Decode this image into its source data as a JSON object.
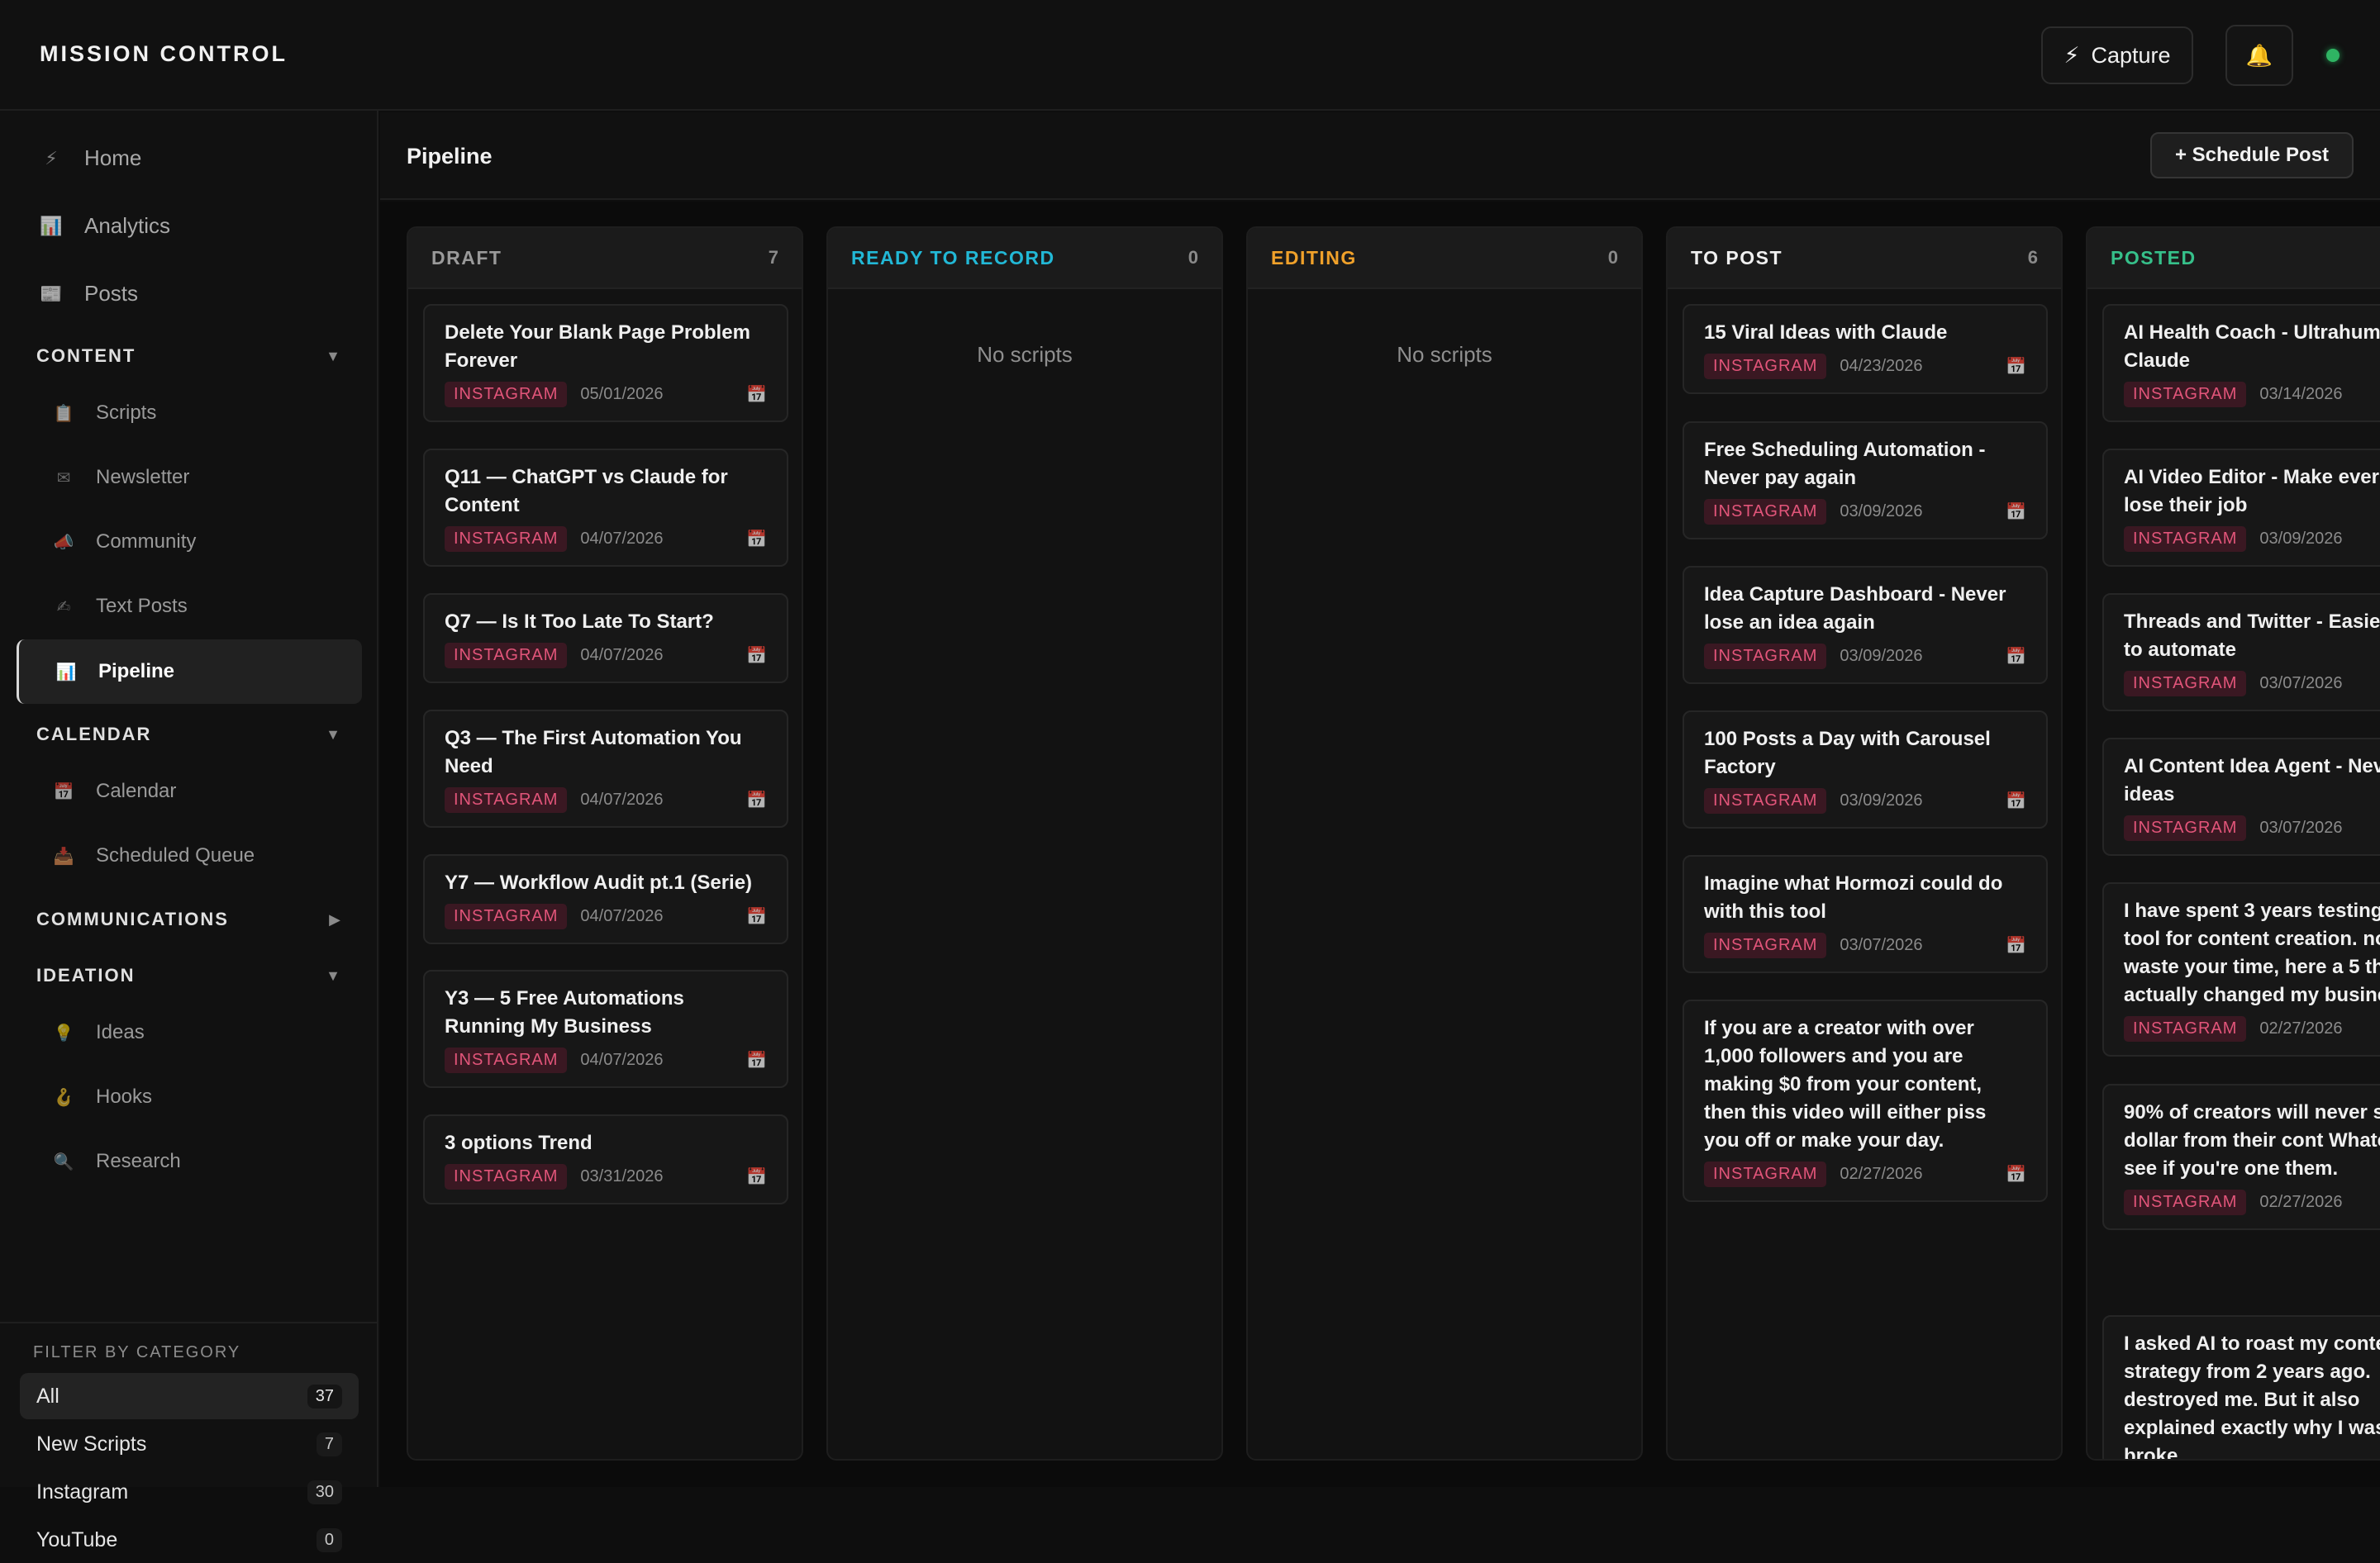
{
  "app": {
    "brand": "MISSION CONTROL"
  },
  "topbar": {
    "capture_label": "Capture",
    "capture_icon": "⚡",
    "bell_icon": "🔔"
  },
  "sidebar": {
    "nav": [
      {
        "label": "Home",
        "icon": "⚡"
      },
      {
        "label": "Analytics",
        "icon": "📊"
      },
      {
        "label": "Posts",
        "icon": "📰"
      }
    ],
    "sections": {
      "content": {
        "title": "CONTENT",
        "chevron": "▼",
        "items": [
          {
            "label": "Scripts",
            "icon": "📋"
          },
          {
            "label": "Newsletter",
            "icon": "✉"
          },
          {
            "label": "Community",
            "icon": "📣"
          },
          {
            "label": "Text Posts",
            "icon": "✍"
          },
          {
            "label": "Pipeline",
            "icon": "📊"
          }
        ]
      },
      "calendar": {
        "title": "CALENDAR",
        "chevron": "▼",
        "items": [
          {
            "label": "Calendar",
            "icon": "📅"
          },
          {
            "label": "Scheduled Queue",
            "icon": "📥"
          }
        ]
      },
      "communications": {
        "title": "COMMUNICATIONS",
        "chevron": "▶"
      },
      "ideation": {
        "title": "IDEATION",
        "chevron": "▼",
        "items": [
          {
            "label": "Ideas",
            "icon": "💡"
          },
          {
            "label": "Hooks",
            "icon": "🪝"
          },
          {
            "label": "Research",
            "icon": "🔍"
          }
        ]
      }
    },
    "filter": {
      "title": "FILTER BY CATEGORY",
      "rows": [
        {
          "label": "All",
          "count": "37"
        },
        {
          "label": "New Scripts",
          "count": "7"
        },
        {
          "label": "Instagram",
          "count": "30"
        },
        {
          "label": "YouTube",
          "count": "0"
        }
      ]
    }
  },
  "main": {
    "title": "Pipeline",
    "schedule_label": "+ Schedule Post"
  },
  "colors": {
    "draft": "#9a9a9a",
    "ready": "#22b8d6",
    "editing": "#f0a12a",
    "to_post": "#f0f0f0",
    "posted": "#36c08a",
    "badge": "#e2557a"
  },
  "columns": {
    "draft": {
      "title": "DRAFT",
      "count": "7",
      "cards": [
        {
          "title": "Delete Your Blank Page Problem Forever",
          "tag": "INSTAGRAM",
          "date": "05/01/2026"
        },
        {
          "title": "Q11 — ChatGPT vs Claude for Content",
          "tag": "INSTAGRAM",
          "date": "04/07/2026"
        },
        {
          "title": "Q7 — Is It Too Late To Start?",
          "tag": "INSTAGRAM",
          "date": "04/07/2026"
        },
        {
          "title": "Q3 — The First Automation You Need",
          "tag": "INSTAGRAM",
          "date": "04/07/2026"
        },
        {
          "title": "Y7 — Workflow Audit pt.1 (Serie)",
          "tag": "INSTAGRAM",
          "date": "04/07/2026"
        },
        {
          "title": "Y3 — 5 Free Automations Running My Business",
          "tag": "INSTAGRAM",
          "date": "04/07/2026"
        },
        {
          "title": "3 options Trend",
          "tag": "INSTAGRAM",
          "date": "03/31/2026"
        }
      ]
    },
    "ready": {
      "title": "READY TO RECORD",
      "count": "0",
      "empty": "No scripts"
    },
    "editing": {
      "title": "EDITING",
      "count": "0",
      "empty": "No scripts"
    },
    "to_post": {
      "title": "TO POST",
      "count": "6",
      "cards": [
        {
          "title": "15 Viral Ideas with Claude",
          "tag": "INSTAGRAM",
          "date": "04/23/2026"
        },
        {
          "title": "Free Scheduling Automation - Never pay again",
          "tag": "INSTAGRAM",
          "date": "03/09/2026"
        },
        {
          "title": "Idea Capture Dashboard - Never lose an idea again",
          "tag": "INSTAGRAM",
          "date": "03/09/2026"
        },
        {
          "title": "100 Posts a Day with Carousel Factory",
          "tag": "INSTAGRAM",
          "date": "03/09/2026"
        },
        {
          "title": "Imagine what Hormozi could do with this tool",
          "tag": "INSTAGRAM",
          "date": "03/07/2026"
        },
        {
          "title": "If you are a creator with over 1,000 followers and you are making $0 from your content, then this video will either piss you off or make your day.",
          "tag": "INSTAGRAM",
          "date": "02/27/2026"
        }
      ]
    },
    "posted": {
      "title": "POSTED",
      "cards": [
        {
          "title": "AI Health Coach - Ultrahum Claude",
          "tag": "INSTAGRAM",
          "date": "03/14/2026"
        },
        {
          "title": "AI Video Editor - Make ever editor lose their job",
          "tag": "INSTAGRAM",
          "date": "03/09/2026"
        },
        {
          "title": "Threads and Twitter - Easie social to automate",
          "tag": "INSTAGRAM",
          "date": "03/07/2026"
        },
        {
          "title": "AI Content Idea Agent - Nev out of ideas",
          "tag": "INSTAGRAM",
          "date": "03/07/2026"
        },
        {
          "title": "I have spent 3 years testing AI tool for content creation. not waste your time, here a 5 that actually changed my business.",
          "tag": "INSTAGRAM",
          "date": "02/27/2026"
        },
        {
          "title": "90% of creators will never single dollar from their cont Whatch to see if you're one them.",
          "tag": "INSTAGRAM",
          "date": "02/27/2026"
        },
        {
          "title": "I asked AI to roast my conte strategy from 2 years ago. destroyed me. But it also explained exactly why I was broke."
        }
      ]
    }
  }
}
